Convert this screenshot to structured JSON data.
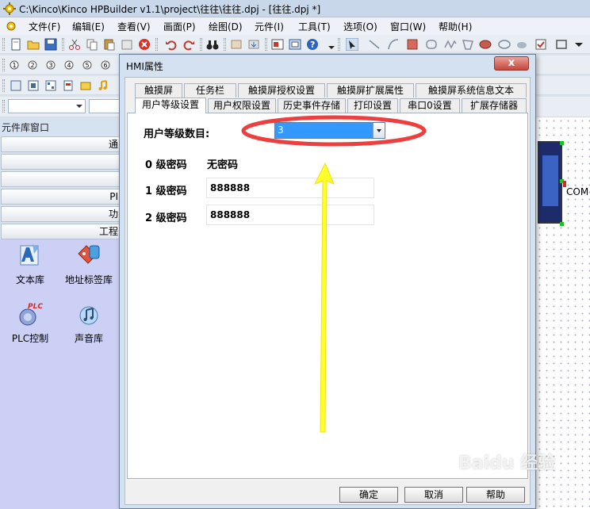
{
  "window": {
    "title": "C:\\Kinco\\Kinco HPBuilder v1.1\\project\\往往\\往往.dpj - [往往.dpj *]"
  },
  "menu": [
    "文件(F)",
    "编辑(E)",
    "查看(V)",
    "画面(P)",
    "绘图(D)",
    "元件(I)",
    "工具(T)",
    "选项(O)",
    "窗口(W)",
    "帮助(H)"
  ],
  "left_panel": {
    "title": "元件库窗口",
    "categories": [
      "通",
      "",
      "",
      "PI",
      "功",
      "工程"
    ],
    "libraries": [
      {
        "label": "文本库",
        "icon": "text-library-icon"
      },
      {
        "label": "地址标签库",
        "icon": "address-tag-library-icon"
      },
      {
        "label": "PLC控制",
        "icon": "plc-control-icon",
        "icon_text": "PLC"
      },
      {
        "label": "声音库",
        "icon": "sound-library-icon"
      }
    ]
  },
  "canvas": {
    "device_label": "COM"
  },
  "dialog": {
    "title": "HMI属性",
    "close_label": "x",
    "tabs_row1": [
      "触摸屏",
      "任务栏",
      "触摸屏授权设置",
      "触摸屏扩展属性",
      "触摸屏系统信息文本"
    ],
    "tabs_row2": [
      "用户等级设置",
      "用户权限设置",
      "历史事件存储",
      "打印设置",
      "串口0设置",
      "扩展存储器"
    ],
    "active_tab": "用户等级设置",
    "user_level_label": "用户等级数目:",
    "user_level_value": "3",
    "levels": [
      {
        "label": "0 级密码",
        "value": "无密码"
      },
      {
        "label": "1 级密码",
        "value": "888888"
      },
      {
        "label": "2 级密码",
        "value": "888888"
      }
    ],
    "buttons": {
      "ok": "确定",
      "cancel": "取消",
      "help": "帮助"
    }
  },
  "watermark": "Baidu 经验",
  "colors": {
    "highlight_ellipse": "#ec3f3f",
    "arrow": "#ffff2a",
    "selected_value_bg": "#3399ff",
    "library_bg": "#ccd0f4"
  }
}
